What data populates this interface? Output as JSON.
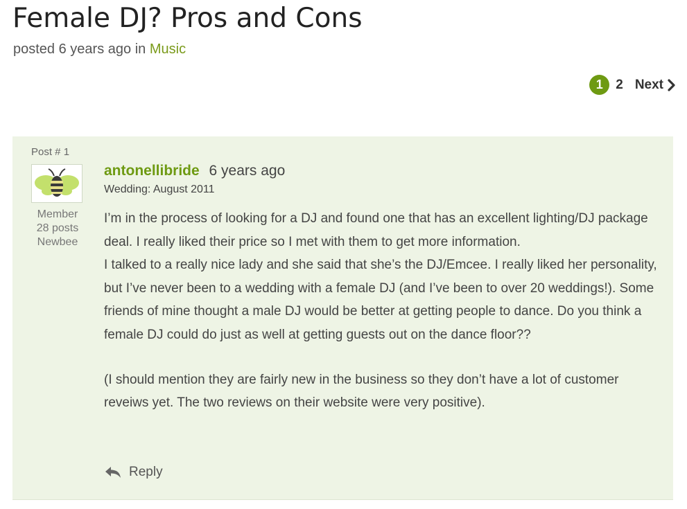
{
  "page": {
    "title": "Female DJ? Pros and Cons",
    "posted_prefix": "posted",
    "posted_time": "6 years ago",
    "in_word": "in",
    "category": "Music"
  },
  "pagination": {
    "current": "1",
    "page2": "2",
    "next": "Next"
  },
  "post": {
    "number": "Post # 1",
    "author": "antonellibride",
    "time": "6 years ago",
    "wedding": "Wedding: August 2011",
    "role": "Member",
    "posts": "28 posts",
    "rank": "Newbee",
    "paragraph1": "I’m in the process of looking for a DJ and found one that has an excellent lighting/DJ package deal. I really liked their price so I met with them to get more information.",
    "paragraph2": "I talked to a really nice lady and she said that she’s the DJ/Emcee. I really liked her personality, but I’ve never been to a wedding with a female DJ (and I’ve been to over 20 weddings!). Some friends of mine thought a male DJ would be better at getting people to dance. Do you think a female DJ could do just as well at getting guests out on the dance floor??",
    "paragraph3": "(I should mention they are fairly new in the business so they don’t have a lot of customer reveiws yet. The two reviews on their website were very positive).",
    "reply_label": "Reply"
  },
  "colors": {
    "accent": "#6e9a12",
    "post_background": "#eef4e5"
  },
  "icons": {
    "avatar": "bee-icon",
    "next": "chevron-right-icon",
    "reply": "reply-arrow-icon"
  }
}
